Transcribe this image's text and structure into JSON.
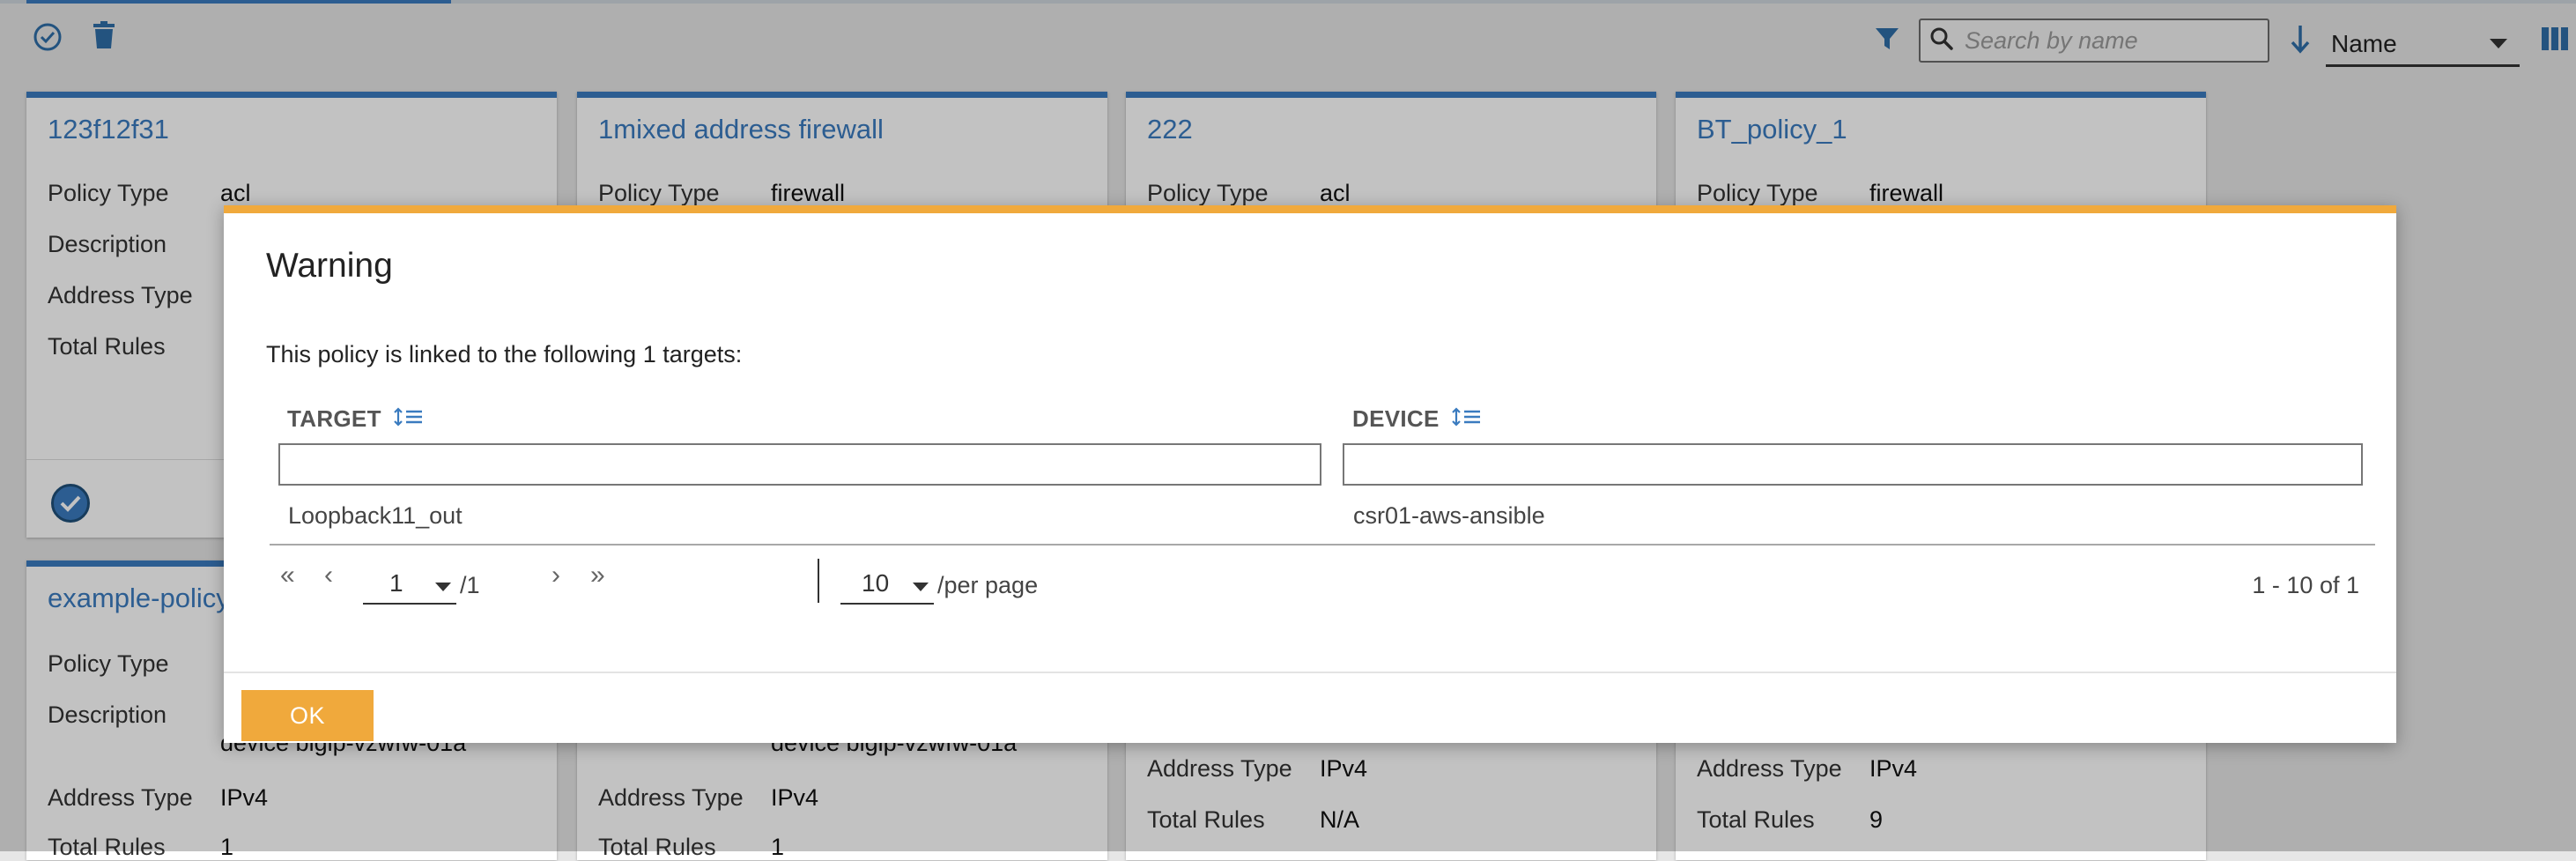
{
  "toolbar": {
    "search_placeholder": "Search by name",
    "sort_value": "Name"
  },
  "cards": [
    {
      "title": "123f12f31",
      "rows": [
        {
          "label": "Policy Type",
          "value": "acl"
        },
        {
          "label": "Description",
          "value": ""
        },
        {
          "label": "Address Type",
          "value": ""
        },
        {
          "label": "Total Rules",
          "value": ""
        }
      ]
    },
    {
      "title": "1mixed address firewall",
      "rows": [
        {
          "label": "Policy Type",
          "value": "firewall"
        }
      ]
    },
    {
      "title": "222",
      "rows": [
        {
          "label": "Policy Type",
          "value": "acl"
        }
      ]
    },
    {
      "title": "BT_policy_1",
      "rows": [
        {
          "label": "Policy Type",
          "value": "firewall"
        }
      ]
    },
    {
      "title": "example-policy",
      "rows": [
        {
          "label": "Policy Type",
          "value": ""
        },
        {
          "label": "Description",
          "value": "device bigip-vzwfw-01a"
        },
        {
          "label": "Address Type",
          "value": "IPv4"
        },
        {
          "label": "Total Rules",
          "value": "1"
        }
      ]
    },
    {
      "title": "",
      "rows": [
        {
          "label": "",
          "value": "device bigip-vzwfw-01a"
        },
        {
          "label": "Address Type",
          "value": "IPv4"
        },
        {
          "label": "Total Rules",
          "value": "1"
        }
      ]
    },
    {
      "title": "",
      "rows": [
        {
          "label": "Address Type",
          "value": "IPv4"
        },
        {
          "label": "Total Rules",
          "value": "N/A"
        }
      ]
    },
    {
      "title": "",
      "rows": [
        {
          "label": "Address Type",
          "value": "IPv4"
        },
        {
          "label": "Total Rules",
          "value": "9"
        }
      ]
    }
  ],
  "modal": {
    "title": "Warning",
    "message": "This policy is linked to the following 1 targets:",
    "columns": [
      "TARGET",
      "DEVICE"
    ],
    "rows": [
      {
        "target": "Loopback11_out",
        "device": "csr01-aws-ansible"
      }
    ],
    "pagination": {
      "page": "1",
      "total_pages": "/1",
      "per_page": "10",
      "per_page_label": "/per page",
      "range": "1 - 10 of 1"
    },
    "ok_label": "OK"
  },
  "colors": {
    "accent_blue": "#3a7bbf",
    "warning_orange": "#f0a93c"
  },
  "icons": [
    "check-circle-icon",
    "trash-icon",
    "filter-icon",
    "search-icon",
    "sort-arrow-down-icon",
    "columns-view-icon",
    "sort-lines-icon",
    "first-page-icon",
    "prev-page-icon",
    "next-page-icon",
    "last-page-icon",
    "chevron-down-icon"
  ]
}
